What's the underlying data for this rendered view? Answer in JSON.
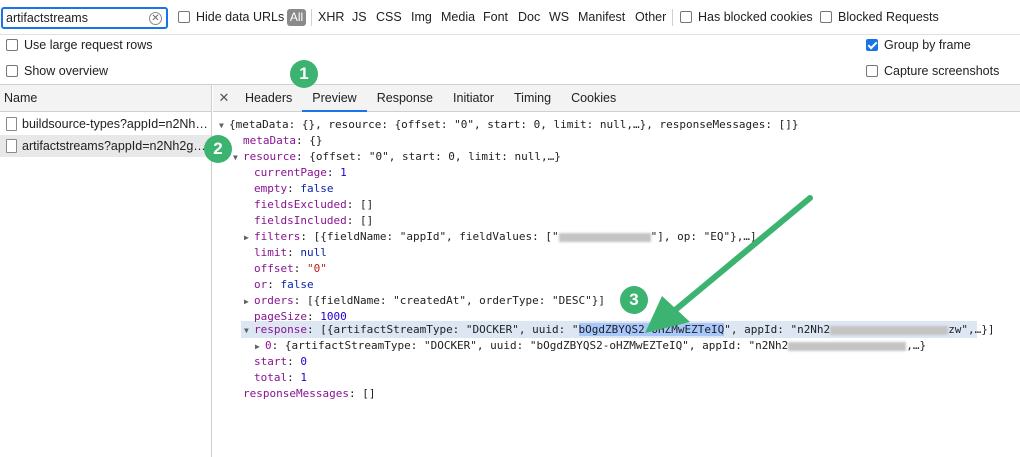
{
  "filterbar": {
    "search_value": "artifactstreams",
    "hide_data_urls": "Hide data URLs",
    "all": "All",
    "types": [
      "XHR",
      "JS",
      "CSS",
      "Img",
      "Media",
      "Font",
      "Doc",
      "WS",
      "Manifest",
      "Other"
    ],
    "has_blocked_cookies": "Has blocked cookies",
    "blocked_requests": "Blocked Requests"
  },
  "options": {
    "large_rows": "Use large request rows",
    "overview": "Show overview",
    "group_by_frame": "Group by frame",
    "capture_screenshots": "Capture screenshots"
  },
  "requests": {
    "header": "Name",
    "items": [
      "buildsource-types?appId=n2Nh…",
      "artifactstreams?appId=n2Nh2g…"
    ]
  },
  "tabs": [
    "Headers",
    "Preview",
    "Response",
    "Initiator",
    "Timing",
    "Cookies"
  ],
  "preview": {
    "root": "{metaData: {}, resource: {offset: \"0\", start: 0, limit: null,…}, responseMessages: []}",
    "metaData_key": "metaData",
    "metaData_val": "{}",
    "resource_key": "resource",
    "resource_val": "{offset: \"0\", start: 0, limit: null,…}",
    "currentPage_key": "currentPage",
    "currentPage_val": "1",
    "empty_key": "empty",
    "empty_val": "false",
    "fieldsExcluded_key": "fieldsExcluded",
    "fieldsExcluded_val": "[]",
    "fieldsIncluded_key": "fieldsIncluded",
    "fieldsIncluded_val": "[]",
    "filters_key": "filters",
    "filters_pre": "[{fieldName: \"appId\", fieldValues: [\"",
    "filters_post": "\"], op: \"EQ\"},…]",
    "limit_key": "limit",
    "limit_val": "null",
    "offset_key": "offset",
    "offset_val": "\"0\"",
    "or_key": "or",
    "or_val": "false",
    "orders_key": "orders",
    "orders_val": "[{fieldName: \"createdAt\", orderType: \"DESC\"}]",
    "pageSize_key": "pageSize",
    "pageSize_val": "1000",
    "response_key": "response",
    "response_pre": "[{artifactStreamType: \"DOCKER\", uuid: \"",
    "response_uuid": "bOgdZBYQS2-oHZMwEZTeIQ",
    "response_mid": "\", appId: \"n2Nh2",
    "response_post": "zw\",…}]",
    "item0_key": "0",
    "item0_pre": "{artifactStreamType: \"DOCKER\", uuid: \"bOgdZBYQS2-oHZMwEZTeIQ\", appId: \"n2Nh2",
    "item0_post": ",…}",
    "start_key": "start",
    "start_val": "0",
    "total_key": "total",
    "total_val": "1",
    "responseMessages_key": "responseMessages",
    "responseMessages_val": "[]"
  },
  "annotations": [
    "1",
    "2",
    "3"
  ],
  "colors": {
    "accent": "#1a73e8",
    "annotation": "#3cb371",
    "key": "#881391",
    "string": "#c41a16",
    "number": "#1c00cf"
  }
}
